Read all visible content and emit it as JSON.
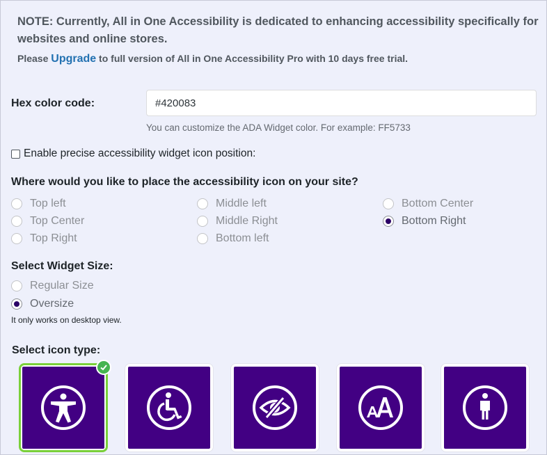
{
  "notice": {
    "text": "NOTE: Currently, All in One Accessibility is dedicated to enhancing accessibility specifically for websites and online stores.",
    "upgrade_prefix": "Please ",
    "upgrade_link": "Upgrade",
    "upgrade_suffix": " to full version of All in One Accessibility Pro with 10 days free trial."
  },
  "hex_color": {
    "label": "Hex color code:",
    "value": "#420083",
    "help": "You can customize the ADA Widget color. For example: FF5733"
  },
  "precise_position": {
    "label": "Enable precise accessibility widget icon position:",
    "checked": false
  },
  "placement": {
    "title": "Where would you like to place the accessibility icon on your site?",
    "options": [
      {
        "label": "Top left",
        "checked": false
      },
      {
        "label": "Top Center",
        "checked": false
      },
      {
        "label": "Top Right",
        "checked": false
      },
      {
        "label": "Middle left",
        "checked": false
      },
      {
        "label": "Middle Right",
        "checked": false
      },
      {
        "label": "Bottom left",
        "checked": false
      },
      {
        "label": "Bottom Center",
        "checked": false
      },
      {
        "label": "Bottom Right",
        "checked": true
      }
    ]
  },
  "widget_size": {
    "title": "Select Widget Size:",
    "options": [
      {
        "label": "Regular Size",
        "checked": false
      },
      {
        "label": "Oversize",
        "checked": true
      }
    ],
    "note": "It only works on desktop view."
  },
  "icon_type": {
    "title": "Select icon type:",
    "icons": [
      {
        "name": "accessibility-person-icon",
        "selected": true
      },
      {
        "name": "wheelchair-icon",
        "selected": false
      },
      {
        "name": "eye-slash-icon",
        "selected": false
      },
      {
        "name": "text-size-aa-icon",
        "selected": false
      },
      {
        "name": "standing-person-icon",
        "selected": false
      }
    ]
  },
  "colors": {
    "widget": "#420083",
    "selected_border": "#7ad03a",
    "link": "#2271b1"
  }
}
